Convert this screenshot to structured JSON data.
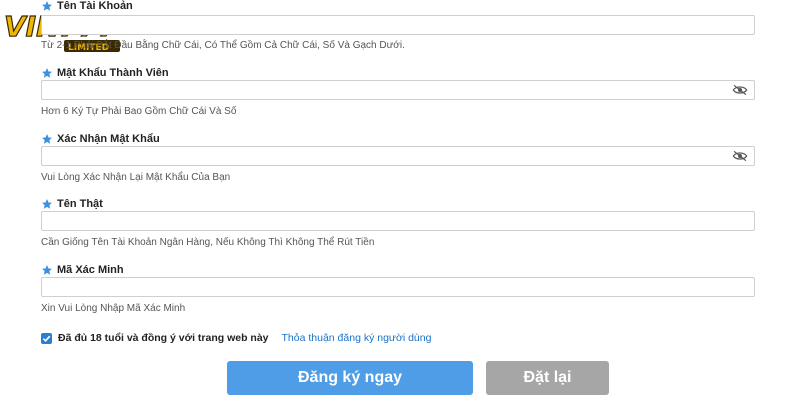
{
  "brand": {
    "logo_text": "VIN777",
    "logo_sub": "LIMITED",
    "colors": {
      "gold": "#f2b705",
      "dark": "#3a2a00"
    }
  },
  "form": {
    "fields": [
      {
        "label": "Tên Tài Khoản",
        "value": "",
        "hint": "Từ 2-1 Phải Bắt Đầu Bằng Chữ Cái, Có Thể Gồm Cả Chữ Cái, Số Và Gạch Dưới.",
        "icon": "star-icon",
        "password": false
      },
      {
        "label": "Mật Khẩu Thành Viên",
        "value": "",
        "hint": "Hơn 6 Ký Tự Phải Bao Gồm Chữ Cái Và Số",
        "icon": "star-icon",
        "password": true
      },
      {
        "label": "Xác Nhận Mật Khẩu",
        "value": "",
        "hint": "Vui Lòng Xác Nhận Lại Mật Khẩu Của Bạn",
        "icon": "star-icon",
        "password": true
      },
      {
        "label": "Tên Thật",
        "value": "",
        "hint": "Cần Giống Tên Tài Khoản Ngân Hàng, Nếu Không Thì Không Thể Rút Tiền",
        "icon": "star-icon",
        "password": false
      },
      {
        "label": "Mã Xác Minh",
        "value": "",
        "hint": "Xin Vui Lòng Nhập Mã Xác Minh",
        "icon": "star-icon",
        "password": false
      }
    ],
    "agreement": {
      "checked": true,
      "text": "Đã đủ 18 tuổi và đồng ý với trang web này",
      "link_text": "Thỏa thuận đăng ký người dùng"
    },
    "buttons": {
      "register": "Đăng ký ngay",
      "reset": "Đặt lại"
    }
  },
  "theme": {
    "star_color": "#3d8fe0",
    "primary_button": "#4e9de6",
    "secondary_button": "#a6a6a6",
    "link_color": "#1a73c8"
  }
}
